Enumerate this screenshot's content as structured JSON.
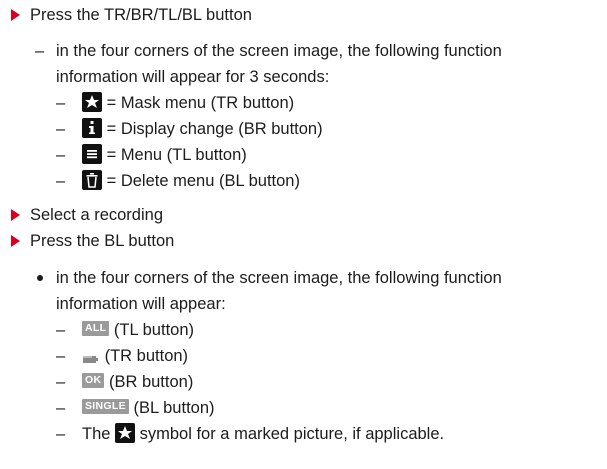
{
  "steps": {
    "step1": "Press the TR/BR/TL/BL button",
    "step1_sub_l1": "in the four corners of the screen image, the following function",
    "step1_sub_l2": "information will appear for 3 seconds:",
    "items1": [
      {
        "icon": "star-square-icon",
        "text": "= Mask menu (TR button)"
      },
      {
        "icon": "info-icon",
        "text": "= Display change (BR button)"
      },
      {
        "icon": "menu-icon",
        "text": "= Menu (TL button)"
      },
      {
        "icon": "delete-icon",
        "text": "= Delete menu (BL button)"
      }
    ],
    "step2": "Select a recording",
    "step3": "Press the BL button",
    "step3_sub_l1": "in the four corners of the screen image, the following function",
    "step3_sub_l2": "information will appear:",
    "items2": [
      {
        "icon_text": "ALL",
        "text": "(TL button)"
      },
      {
        "icon": "battery-icon",
        "text": "(TR button)"
      },
      {
        "icon_text": "OK",
        "text": "(BR button)"
      },
      {
        "icon_text": "SINGLE",
        "text": "(BL button)"
      }
    ],
    "last_pre": "The",
    "last_post": "symbol for a marked picture, if applicable."
  },
  "colors": {
    "arrow": "#d9001b",
    "text": "#1c1c1c",
    "icon_dark": "#111111",
    "icon_gray": "#9a9a9a"
  }
}
